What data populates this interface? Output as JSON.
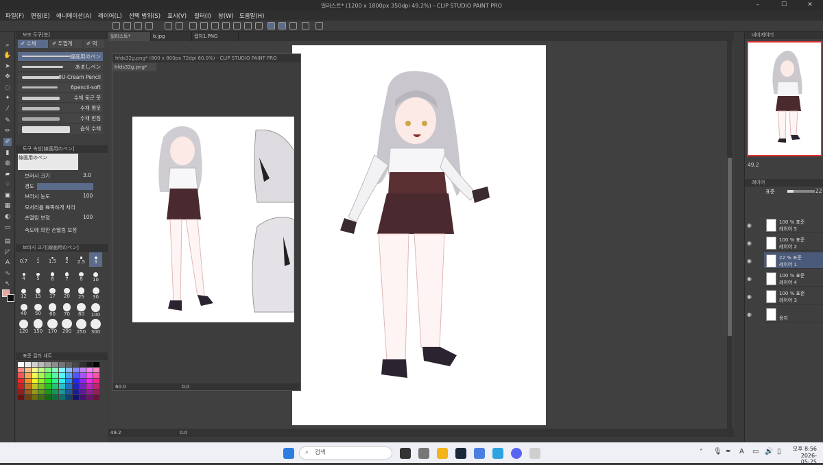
{
  "window": {
    "title": "일러스트* (1200 x 1800px 350dpi 49.2%) - CLIP STUDIO PAINT PRO"
  },
  "menu": [
    "파일(F)",
    "편집(E)",
    "애니메이션(A)",
    "레이어(L)",
    "선택 범위(S)",
    "표시(V)",
    "필터(I)",
    "창(W)",
    "도움말(H)"
  ],
  "sub_tool": {
    "header": "보조 도구[붓]",
    "tabs": [
      "수채",
      "두껍게",
      "먹"
    ],
    "brushes": [
      "線画用のペン",
      "あましペン",
      "8U-Cream Pencil",
      "6pencil-soft",
      "수채 둥근 붓",
      "수채 평붓",
      "수채 번짐",
      "습식 수채"
    ]
  },
  "tool_property": {
    "header": "도구 속성[線画用のペン]",
    "preview_label": "線画用のペン",
    "brush_size_label": "브러시 크기",
    "brush_size_value": "3.0",
    "hardness_label": "경도",
    "density_label": "브러시 농도",
    "density_value": "100",
    "corners_label": "모서리를 뾰족하게 처리",
    "stabilize_label": "손떨림 보정",
    "stabilize_value": "100",
    "speed_label": "속도에 의한 손떨림 보정"
  },
  "brush_size_panel": {
    "header": "브러시 크기[線画用のペン]",
    "sizes": [
      "0.7",
      "1",
      "1.5",
      "2",
      "2.5",
      "3",
      "4",
      "5",
      "6",
      "7",
      "8",
      "10",
      "12",
      "15",
      "17",
      "20",
      "25",
      "30",
      "40",
      "50",
      "60",
      "70",
      "80",
      "100",
      "120",
      "150",
      "170",
      "200",
      "250",
      "300"
    ]
  },
  "color_set": {
    "header": "표준 컬러 세트"
  },
  "tabs": [
    {
      "label": "일러스트*",
      "active": true
    },
    {
      "label": "b.jpg"
    },
    {
      "label": "캡처1.PNG"
    }
  ],
  "subwindow": {
    "title": "hfds32g.png* (800 x 800px 72dpi 60.0%) - CLIP STUDIO PAINT PRO",
    "tab": "hfds32g.png*",
    "zoom": "60.0",
    "angle": "0.0"
  },
  "status": {
    "zoom": "49.2",
    "angle": "0.0"
  },
  "navigator": {
    "header": "내비게이터",
    "zoom": "49.2"
  },
  "layer_panel": {
    "header": "레이어",
    "blend_mode": "표준",
    "opacity": "22",
    "layers": [
      {
        "l1": "100 % 표준",
        "l2": "레이어 5",
        "selected": false
      },
      {
        "l1": "100 % 표준",
        "l2": "레이어 2",
        "selected": false
      },
      {
        "l1": "22 % 표준",
        "l2": "레이어 1",
        "selected": true
      },
      {
        "l1": "100 % 표준",
        "l2": "레이어 4",
        "selected": false
      },
      {
        "l1": "100 % 표준",
        "l2": "레이어 3",
        "selected": false
      },
      {
        "l1": "",
        "l2": "용지",
        "selected": false
      }
    ]
  },
  "taskbar": {
    "search_placeholder": "검색",
    "time": "오후 8:56",
    "date": "2026-05-25"
  },
  "colors": {
    "accent": "#5b6b8a",
    "selected_layer": "#4a5a7a",
    "current_color": "#e8a9a0"
  }
}
